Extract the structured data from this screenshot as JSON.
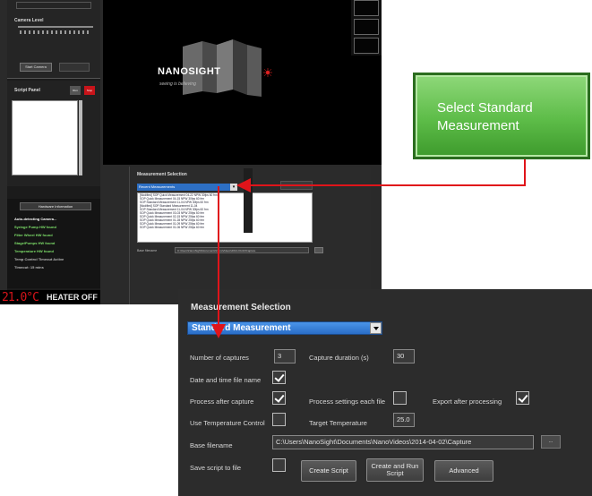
{
  "small_window": {
    "camera_level_label": "Camera Level",
    "start_camera_label": "Start Camera",
    "script_panel_label": "Script Panel",
    "run_label": "Run",
    "stop_label": "Stop",
    "hardware_title": "Hardware Information",
    "hardware_lines": [
      {
        "text": "Auto-detecting Camera...",
        "color": "#ffffff"
      },
      {
        "text": "Syringe Pump HW found",
        "color": "#7ee06a"
      },
      {
        "text": "Filter Wheel HW found",
        "color": "#7ee06a"
      },
      {
        "text": "Stage/Pumps HW found",
        "color": "#7ee06a"
      },
      {
        "text": "Temperature HW found",
        "color": "#7ee06a"
      },
      {
        "text": "Temp Control Timeout Active",
        "color": "#bbbbbb"
      },
      {
        "text": "Timeout: 15 mins",
        "color": "#bbbbbb"
      }
    ],
    "heater_temp": "21.0°C",
    "heater_status": "HEATER OFF",
    "logo_nano": "NANO",
    "logo_sight": "SIGHT",
    "logo_tagline": "seeing is believing",
    "meas_title": "Measurement Selection",
    "meas_selected": "Recent Measurements",
    "recent_list": [
      "[Modified] SOP Quick Measurement 04-22 NPW 30fps 60 frm",
      "SOP Quick Measurement 04-15 NPW 30fps 60 frm",
      "SOP Standard Measurement 11-04 NPW 30fps 60 frm",
      "[Modified] SOP Standard Measurement 11-04",
      "SOP Standard Measurement 11-04 NPW 30fps 60 frm",
      "SOP Quick Measurement 03-03 NPW 25fps 60 frm",
      "SOP Quick Measurement 02-15 NPW 25fps 60 frm",
      "SOP Quick Measurement 01-28 NPW 25fps 60 frm",
      "SOP Quick Measurement 01-09 NPW 25fps 60 frm",
      "SOP Quick Measurement 01-06 NPW 25fps 60 frm"
    ],
    "base_filename_label": "Base filename",
    "base_filename_value": "C:\\Users\\NanoSight\\Documents\\NanoVideos\\2014-04-02\\Capture"
  },
  "callout": {
    "text": "Select Standard Measurement"
  },
  "zoom_panel": {
    "title": "Measurement Selection",
    "selected": "Standard Measurement",
    "number_of_captures_label": "Number of captures",
    "number_of_captures_value": "3",
    "capture_duration_label": "Capture duration (s)",
    "capture_duration_value": "30",
    "date_time_label": "Date and time file name",
    "date_time_checked": true,
    "process_after_label": "Process after capture",
    "process_after_checked": true,
    "process_each_label": "Process settings each file",
    "process_each_checked": false,
    "export_after_label": "Export after processing",
    "export_after_checked": true,
    "use_temp_label": "Use Temperature Control",
    "use_temp_checked": false,
    "target_temp_label": "Target Temperature",
    "target_temp_value": "25.0",
    "base_filename_label": "Base filename",
    "base_filename_value": "C:\\Users\\NanoSight\\Documents\\NanoVideos\\2014-04-02\\Capture",
    "browse_label": "...",
    "save_script_label": "Save script to file",
    "save_script_checked": false,
    "create_script_label": "Create Script",
    "create_run_label": "Create and Run Script",
    "advanced_label": "Advanced"
  },
  "colors": {
    "arrow": "#e0141a",
    "callout_green": "#5dbc48",
    "select_blue": "#2a6ec8"
  }
}
